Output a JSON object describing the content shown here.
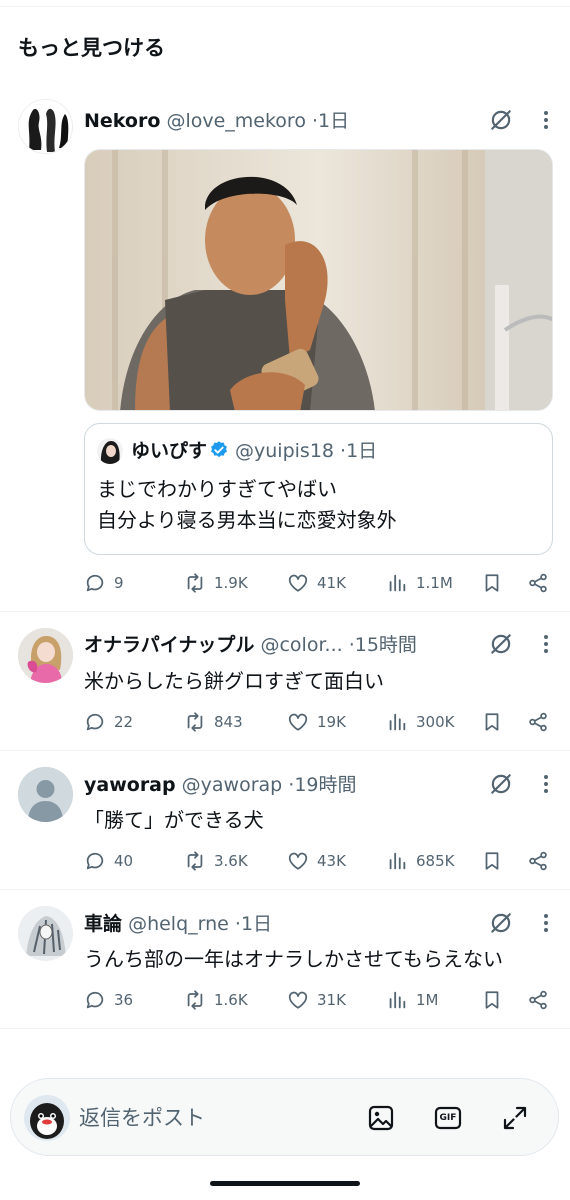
{
  "section": {
    "title": "もっと見つける"
  },
  "tweets": [
    {
      "name": "Nekoro",
      "handle": "@love_mekoro",
      "dot": "·",
      "time": "1日",
      "quote": {
        "name": "ゆいぴす",
        "handle": "@yuipis18",
        "dot": "·",
        "time": "1日",
        "lines": [
          "まじでわかりすぎてやばい",
          "自分より寝る男本当に恋愛対象外"
        ]
      },
      "replies": "9",
      "reposts": "1.9K",
      "likes": "41K",
      "views": "1.1M"
    },
    {
      "name": "オナラパイナップル",
      "handle": "@color...",
      "dot": "·",
      "time": "15時間",
      "text": "米からしたら餅グロすぎて面白い",
      "replies": "22",
      "reposts": "843",
      "likes": "19K",
      "views": "300K"
    },
    {
      "name": "yaworap",
      "handle": "@yaworap",
      "dot": "·",
      "time": "19時間",
      "text": "「勝て」ができる犬",
      "replies": "40",
      "reposts": "3.6K",
      "likes": "43K",
      "views": "685K"
    },
    {
      "name": "車論",
      "handle": "@helq_rne",
      "dot": "·",
      "time": "1日",
      "text": "うんち部の一年はオナラしかさせてもらえない",
      "replies": "36",
      "reposts": "1.6K",
      "likes": "31K",
      "views": "1M"
    }
  ],
  "composer": {
    "placeholder": "返信をポスト",
    "gif_label": "GIF"
  },
  "colors": {
    "text": "#0f1419",
    "secondary": "#536471",
    "verified": "#1d9bf0",
    "border": "#eff3f4"
  },
  "icons": [
    "grok-icon",
    "more-icon",
    "reply-icon",
    "repost-icon",
    "like-icon",
    "views-icon",
    "bookmark-icon",
    "share-icon",
    "image-icon",
    "gif-icon",
    "expand-icon",
    "verified-badge-icon"
  ]
}
